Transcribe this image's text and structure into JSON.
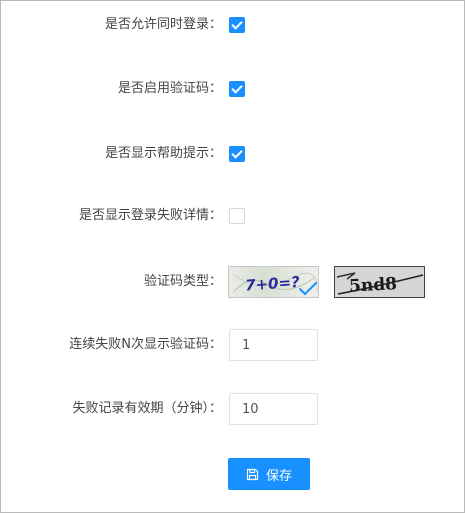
{
  "settings": {
    "allow_concurrent_login": {
      "label": "是否允许同时登录：",
      "checked": true
    },
    "enable_captcha": {
      "label": "是否启用验证码：",
      "checked": true
    },
    "show_help_hint": {
      "label": "是否显示帮助提示：",
      "checked": true
    },
    "show_login_failure_details": {
      "label": "是否显示登录失败详情：",
      "checked": false
    }
  },
  "captcha_type": {
    "label": "验证码类型：",
    "options": [
      {
        "text": "7+0=?",
        "selected": true
      },
      {
        "text": "5nd8",
        "selected": false
      }
    ]
  },
  "captcha_after_failures": {
    "label": "连续失败N次显示验证码：",
    "value": "1"
  },
  "failure_record_validity": {
    "label": "失败记录有效期（分钟）：",
    "value": "10"
  },
  "save_button": {
    "label": "保存",
    "icon": "save-icon"
  },
  "colors": {
    "primary": "#1890ff",
    "checkbox_border": "#d9d9d9",
    "input_border": "#dcdfe6"
  }
}
